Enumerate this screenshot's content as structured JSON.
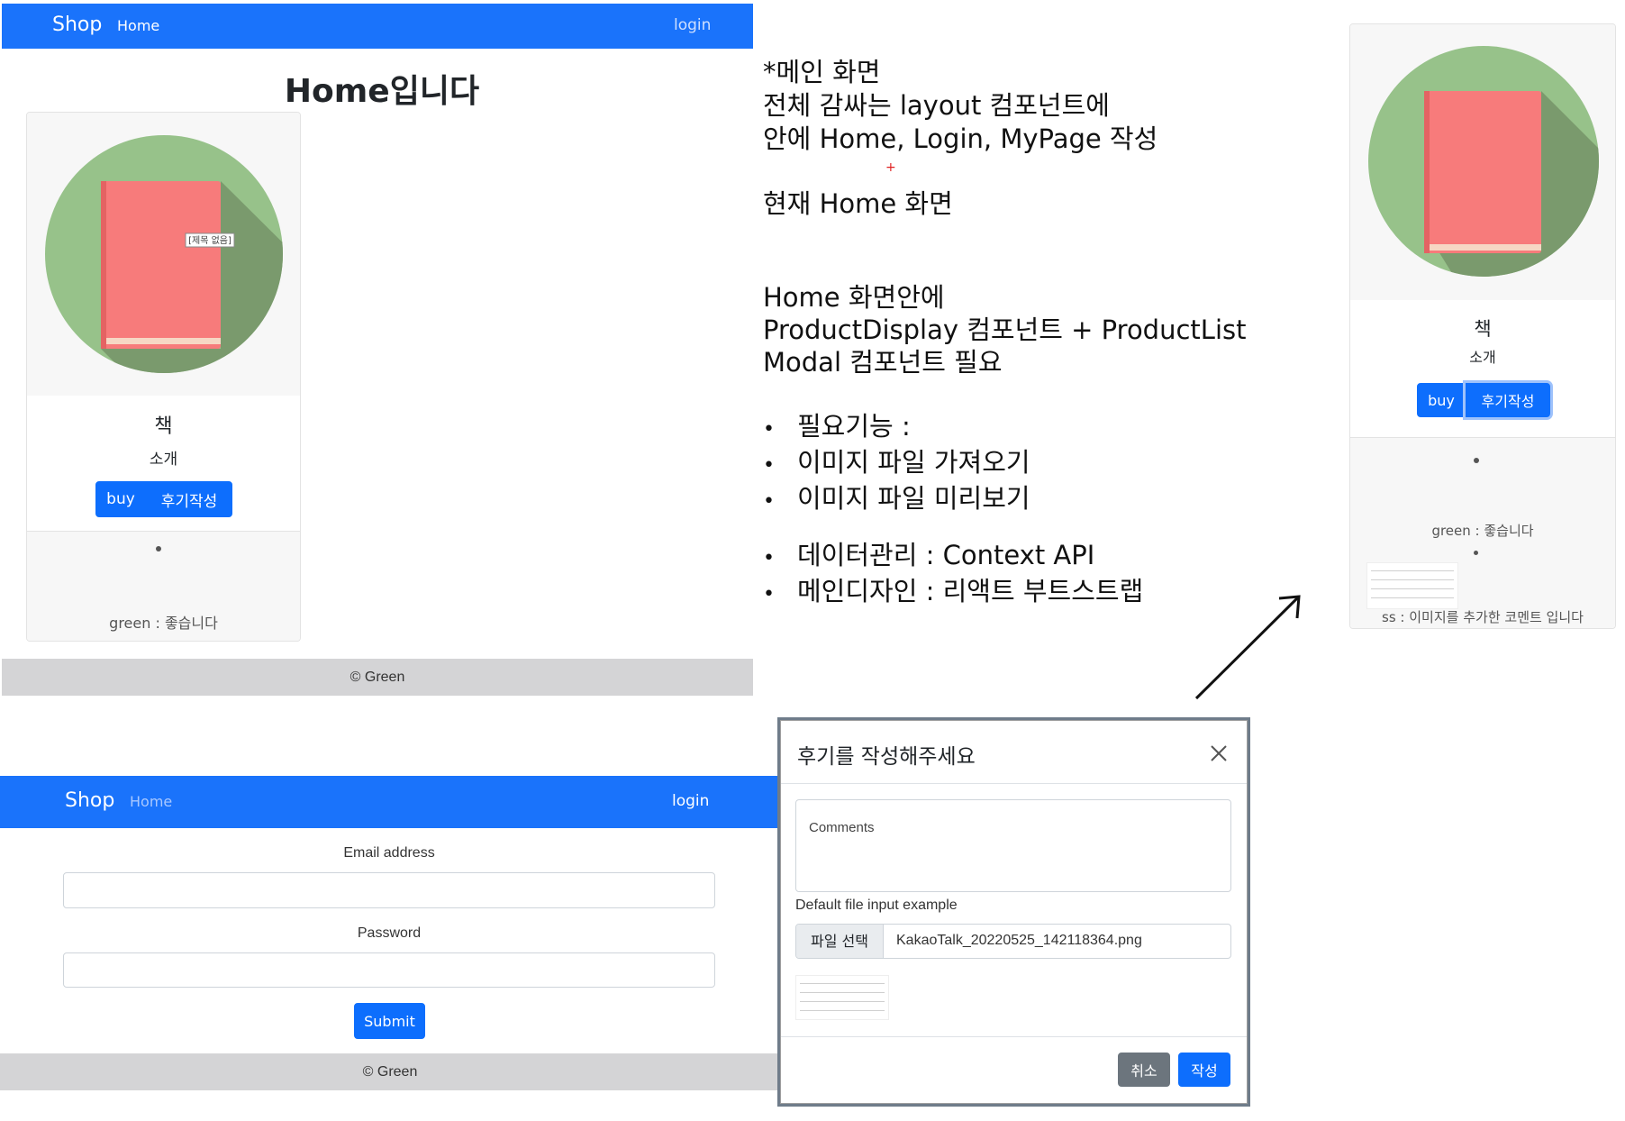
{
  "home_panel": {
    "navbar": {
      "brand": "Shop",
      "home": "Home",
      "login": "login"
    },
    "page_title": "Home입니다",
    "card": {
      "image_overlay_text": "[제목 없음]",
      "title": "책",
      "subtitle": "소개",
      "buy_label": "buy",
      "review_label": "후기작성",
      "comment": "green : 좋습니다"
    },
    "footer": "© Green"
  },
  "notes": {
    "block1": [
      "*메인 화면",
      "전체 감싸는 layout 컴포넌트에",
      "안에 Home, Login, MyPage 작성"
    ],
    "plus": "+",
    "block2": "현재 Home 화면",
    "block3": [
      "Home 화면안에",
      "ProductDisplay 컴포넌트 + ProductList",
      "Modal 컴포넌트 필요"
    ],
    "bullets1": [
      "필요기능 :",
      "이미지 파일 가져오기",
      "이미지 파일 미리보기"
    ],
    "bullets2": [
      "데이터관리 : Context API",
      "메인디자인 : 리액트 부트스트랩"
    ]
  },
  "right_card": {
    "title": "책",
    "subtitle": "소개",
    "buy_label": "buy",
    "review_label": "후기작성",
    "comment1": "green : 좋습니다",
    "comment2": "ss : 이미지를 추가한 코멘트 입니다"
  },
  "login_panel": {
    "navbar": {
      "brand": "Shop",
      "home": "Home",
      "login": "login"
    },
    "email_label": "Email address",
    "password_label": "Password",
    "submit_label": "Submit",
    "footer": "© Green"
  },
  "modal": {
    "title": "후기를 작성해주세요",
    "comments_placeholder": "Comments",
    "file_label": "Default file input example",
    "file_button": "파일 선택",
    "file_name": "KakaoTalk_20220525_142118364.png",
    "cancel_label": "취소",
    "submit_label": "작성"
  },
  "colors": {
    "primary": "#1a73fb",
    "button": "#0d6efd",
    "secondary": "#6c757d",
    "footer_bg": "#d4d4d6",
    "book": "#f77b7b",
    "circle": "#97c28a"
  },
  "icons": [
    "book-icon",
    "close-icon",
    "arrow-icon"
  ]
}
